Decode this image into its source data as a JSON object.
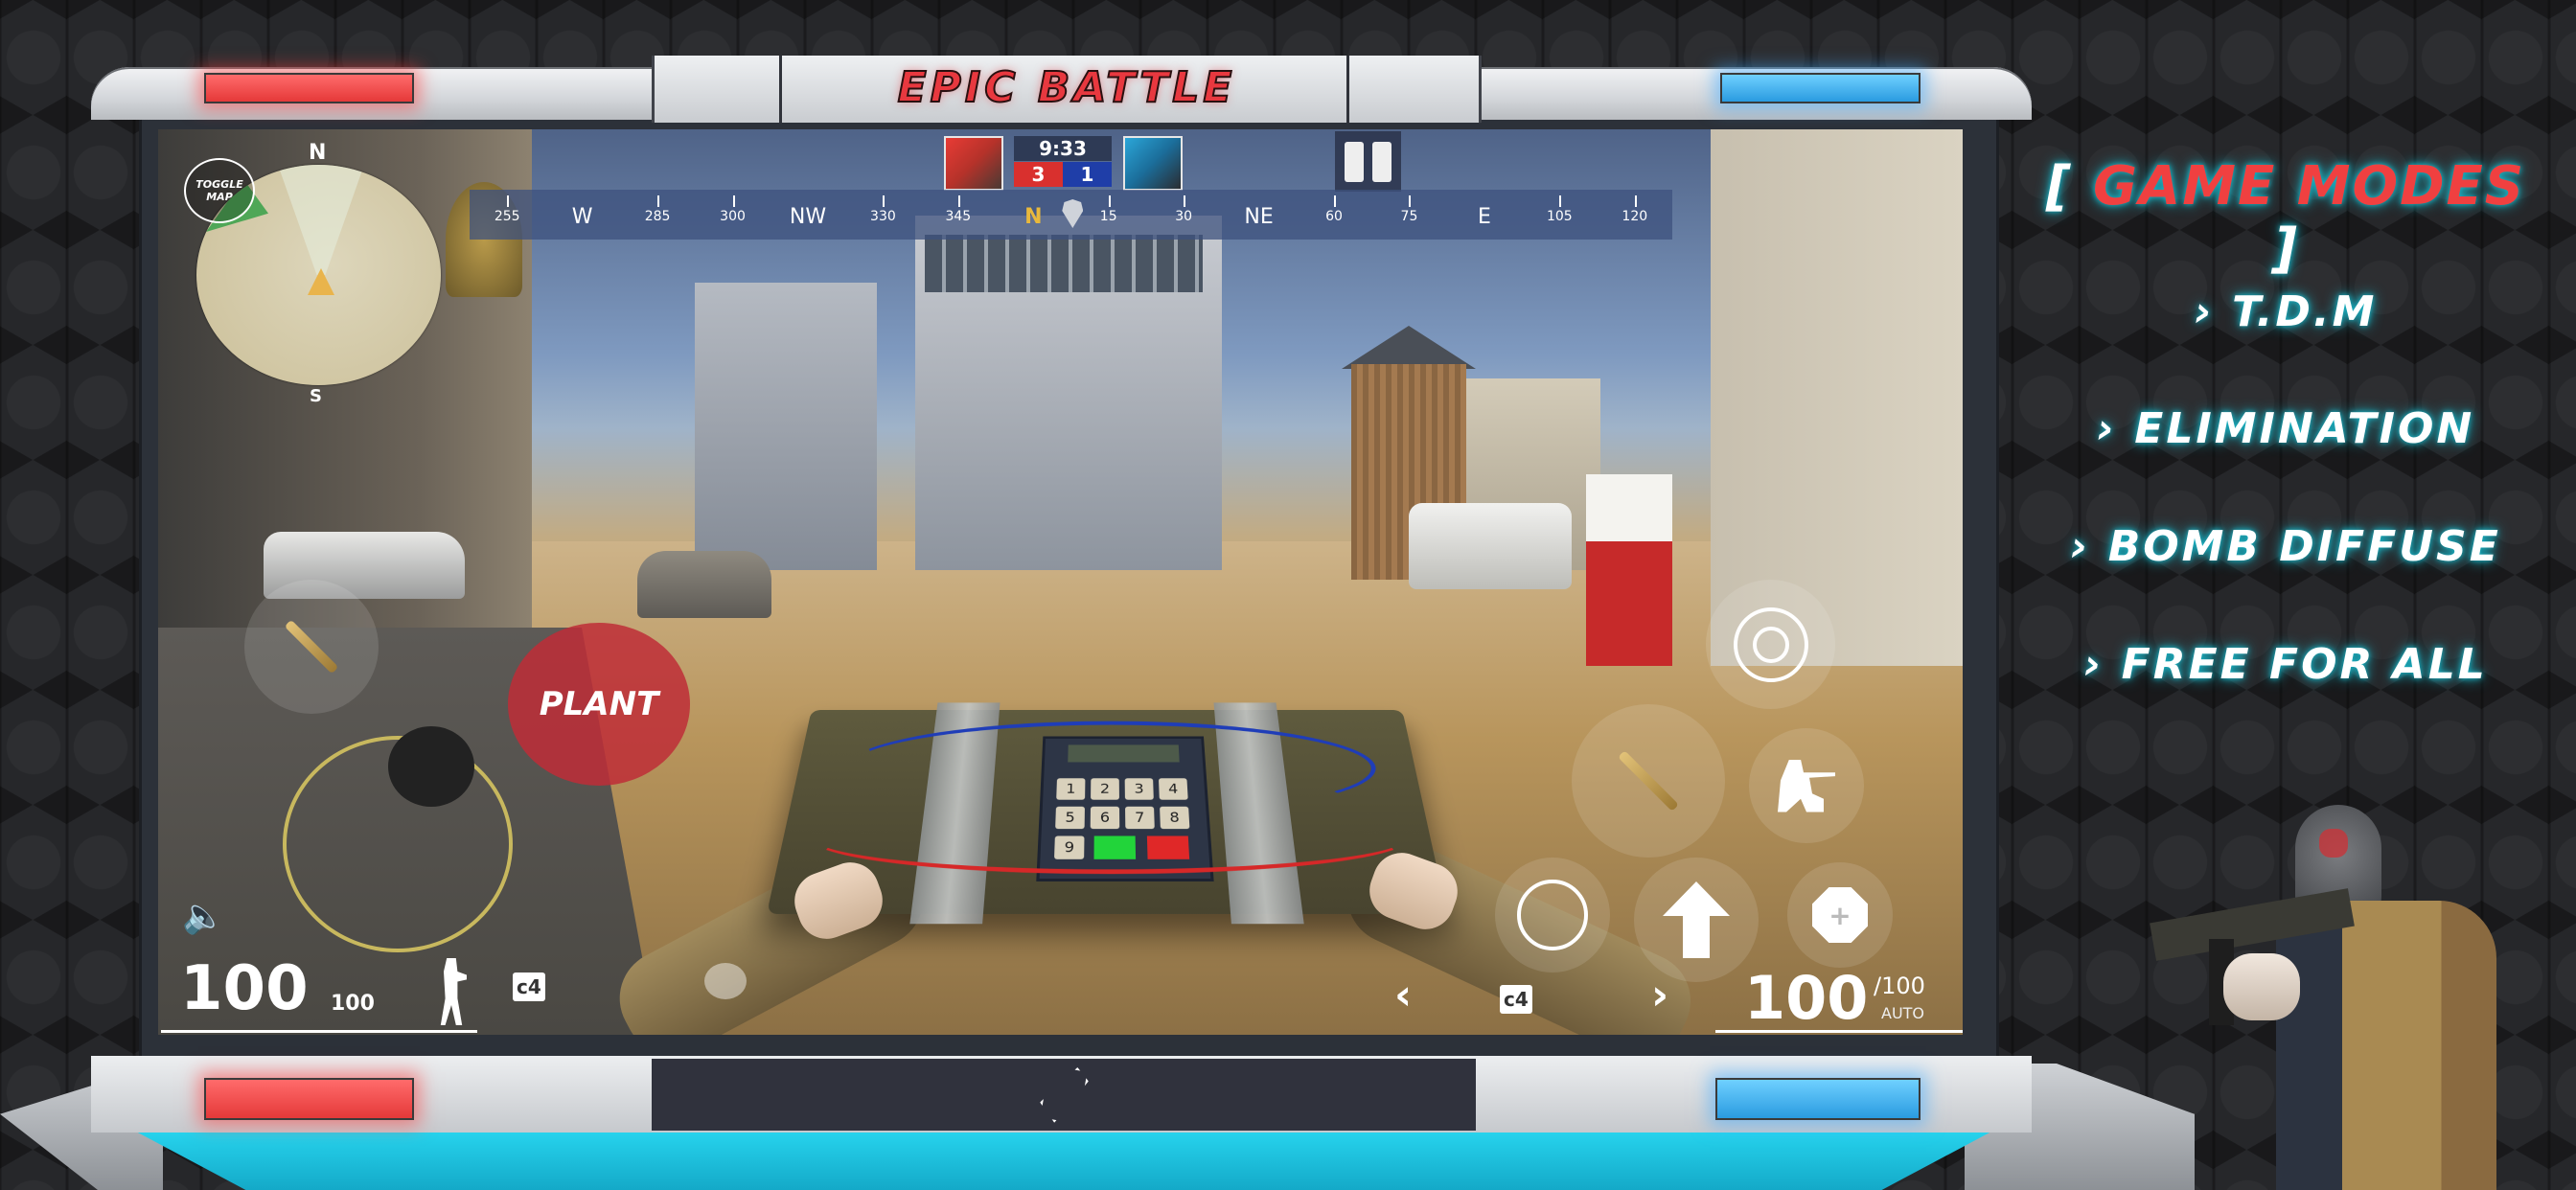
{
  "frame": {
    "title": "EPIC BATTLE",
    "accent_red": "#e8383f",
    "accent_blue": "#2a9be0",
    "glow_cyan": "#18b6c8"
  },
  "hud": {
    "minimap": {
      "toggle_label_1": "TOGGLE",
      "toggle_label_2": "MAP",
      "north": "N",
      "south": "S"
    },
    "scoreboard": {
      "timer": "9:33",
      "red_score": "3",
      "blue_score": "1",
      "red_color": "#d9302e",
      "blue_color": "#1f3ea8"
    },
    "compass": {
      "marks": [
        {
          "label": "255",
          "cardinal": false
        },
        {
          "label": "W",
          "cardinal": true
        },
        {
          "label": "285",
          "cardinal": false
        },
        {
          "label": "300",
          "cardinal": false
        },
        {
          "label": "NW",
          "cardinal": true
        },
        {
          "label": "330",
          "cardinal": false
        },
        {
          "label": "345",
          "cardinal": false
        },
        {
          "label": "N",
          "cardinal": true,
          "heading": true
        },
        {
          "label": "15",
          "cardinal": false
        },
        {
          "label": "30",
          "cardinal": false
        },
        {
          "label": "NE",
          "cardinal": true
        },
        {
          "label": "60",
          "cardinal": false
        },
        {
          "label": "75",
          "cardinal": false
        },
        {
          "label": "E",
          "cardinal": true
        },
        {
          "label": "105",
          "cardinal": false
        },
        {
          "label": "120",
          "cardinal": false
        }
      ]
    },
    "plant_label": "PLANT",
    "health": "100",
    "armor": "100",
    "ammo": "100",
    "ammo_max": "/100",
    "fire_mode": "AUTO",
    "c4_label": "c4",
    "icons": {
      "sound": "speaker-icon",
      "stance": "soldier-icon",
      "bomb": "c4-icon",
      "chat": "chat-icon",
      "aim": "crosshair-icon",
      "crouch": "crouch-icon",
      "reload": "reload-icon",
      "jump": "arrow-up-icon",
      "medkit": "medkit-icon",
      "pause": "pause-icon"
    }
  },
  "game_modes": {
    "title_open": "[",
    "title": "GAME MODES",
    "title_close": "]",
    "items": [
      {
        "label": "T.D.M"
      },
      {
        "label": "ELIMINATION"
      },
      {
        "label": "BOMB DIFFUSE"
      },
      {
        "label": "FREE FOR ALL"
      }
    ]
  },
  "bomb_keypad": [
    "1",
    "2",
    "3",
    "4",
    "5",
    "6",
    "7",
    "8",
    "9"
  ]
}
